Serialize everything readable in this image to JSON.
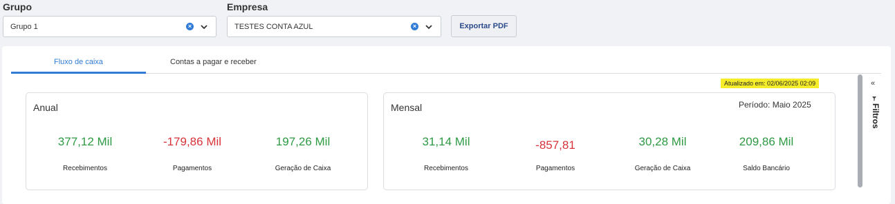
{
  "filters": {
    "grupo": {
      "label": "Grupo",
      "value": "Grupo 1"
    },
    "empresa": {
      "label": "Empresa",
      "value": "TESTES CONTA AZUL"
    },
    "export_label": "Exportar PDF"
  },
  "tabs": [
    {
      "label": "Fluxo de caixa",
      "active": true
    },
    {
      "label": "Contas a pagar e receber",
      "active": false
    }
  ],
  "updated_at": "Atualizado em: 02/06/2025 02:09",
  "anual": {
    "title": "Anual",
    "metrics": [
      {
        "value": "377,12 Mil",
        "label": "Recebimentos",
        "tone": "positive"
      },
      {
        "value": "-179,86 Mil",
        "label": "Pagamentos",
        "tone": "negative"
      },
      {
        "value": "197,26 Mil",
        "label": "Geração de Caixa",
        "tone": "positive"
      }
    ]
  },
  "mensal": {
    "title": "Mensal",
    "period": "Período: Maio 2025",
    "metrics": [
      {
        "value": "31,14 Mil",
        "label": "Recebimentos",
        "tone": "positive"
      },
      {
        "value": "-857,81",
        "label": "Pagamentos",
        "tone": "negative"
      },
      {
        "value": "30,28 Mil",
        "label": "Geração de Caixa",
        "tone": "positive"
      },
      {
        "value": "209,86 Mil",
        "label": "Saldo Bancário",
        "tone": "positive"
      }
    ]
  },
  "side_panel": {
    "label": "Filtros"
  },
  "colors": {
    "accent": "#2f7bd6",
    "positive": "#2e9a44",
    "negative": "#d8333a",
    "highlight": "#f5ec2a"
  }
}
